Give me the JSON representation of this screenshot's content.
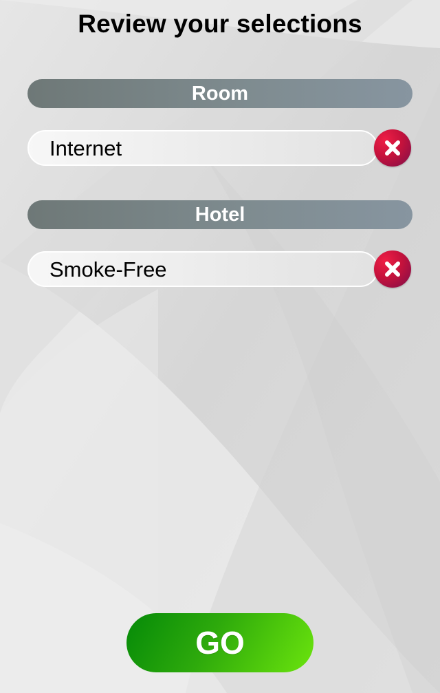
{
  "screen": {
    "title": "Review your selections"
  },
  "sections": [
    {
      "header": "Room",
      "items": [
        {
          "label": "Internet",
          "remove_icon": "close-icon"
        }
      ]
    },
    {
      "header": "Hotel",
      "items": [
        {
          "label": "Smoke-Free",
          "remove_icon": "close-icon"
        }
      ]
    }
  ],
  "actions": {
    "go_label": "GO"
  },
  "colors": {
    "header_bar": "#7e8b8f",
    "remove_button": "#c5123c",
    "go_button": "#2eaa0c",
    "background": "#dcdcdc"
  }
}
